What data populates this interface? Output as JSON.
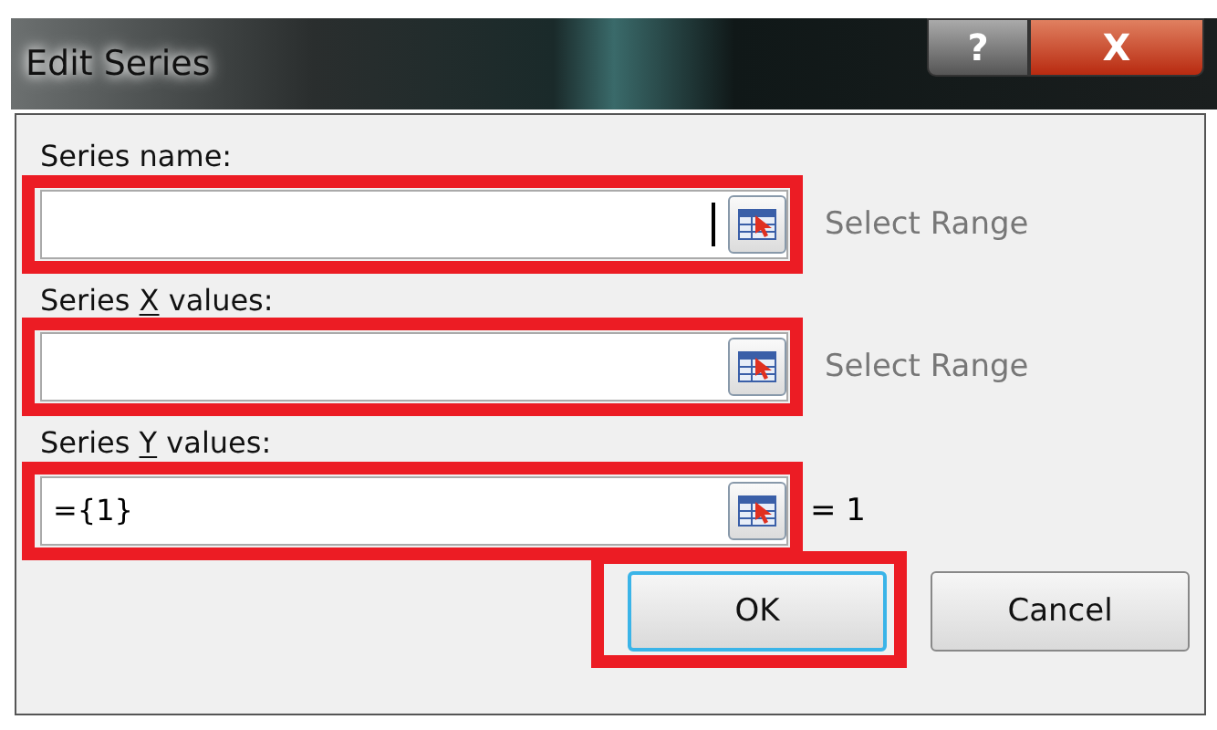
{
  "window": {
    "title": "Edit Series",
    "controls": [
      {
        "kind": "help",
        "label": "?"
      },
      {
        "kind": "close",
        "label": "X"
      }
    ]
  },
  "fields": [
    {
      "label_prefix": "Series name:",
      "cursor": true,
      "note": "Select Range",
      "highlighted": true
    },
    {
      "label_prefix": "Series ",
      "accelerator": "X",
      "label_suffix": " values:",
      "cursor": false,
      "note": "Select Range",
      "highlighted": true
    },
    {
      "label_prefix": "Series ",
      "accelerator": "Y",
      "label_suffix": " values:",
      "value": "={1}",
      "cursor": false,
      "note": "= 1",
      "highlighted": true
    }
  ],
  "buttons": [
    {
      "label": "OK",
      "default": true,
      "highlighted": true
    },
    {
      "label": "Cancel",
      "default": false,
      "highlighted": false
    }
  ]
}
